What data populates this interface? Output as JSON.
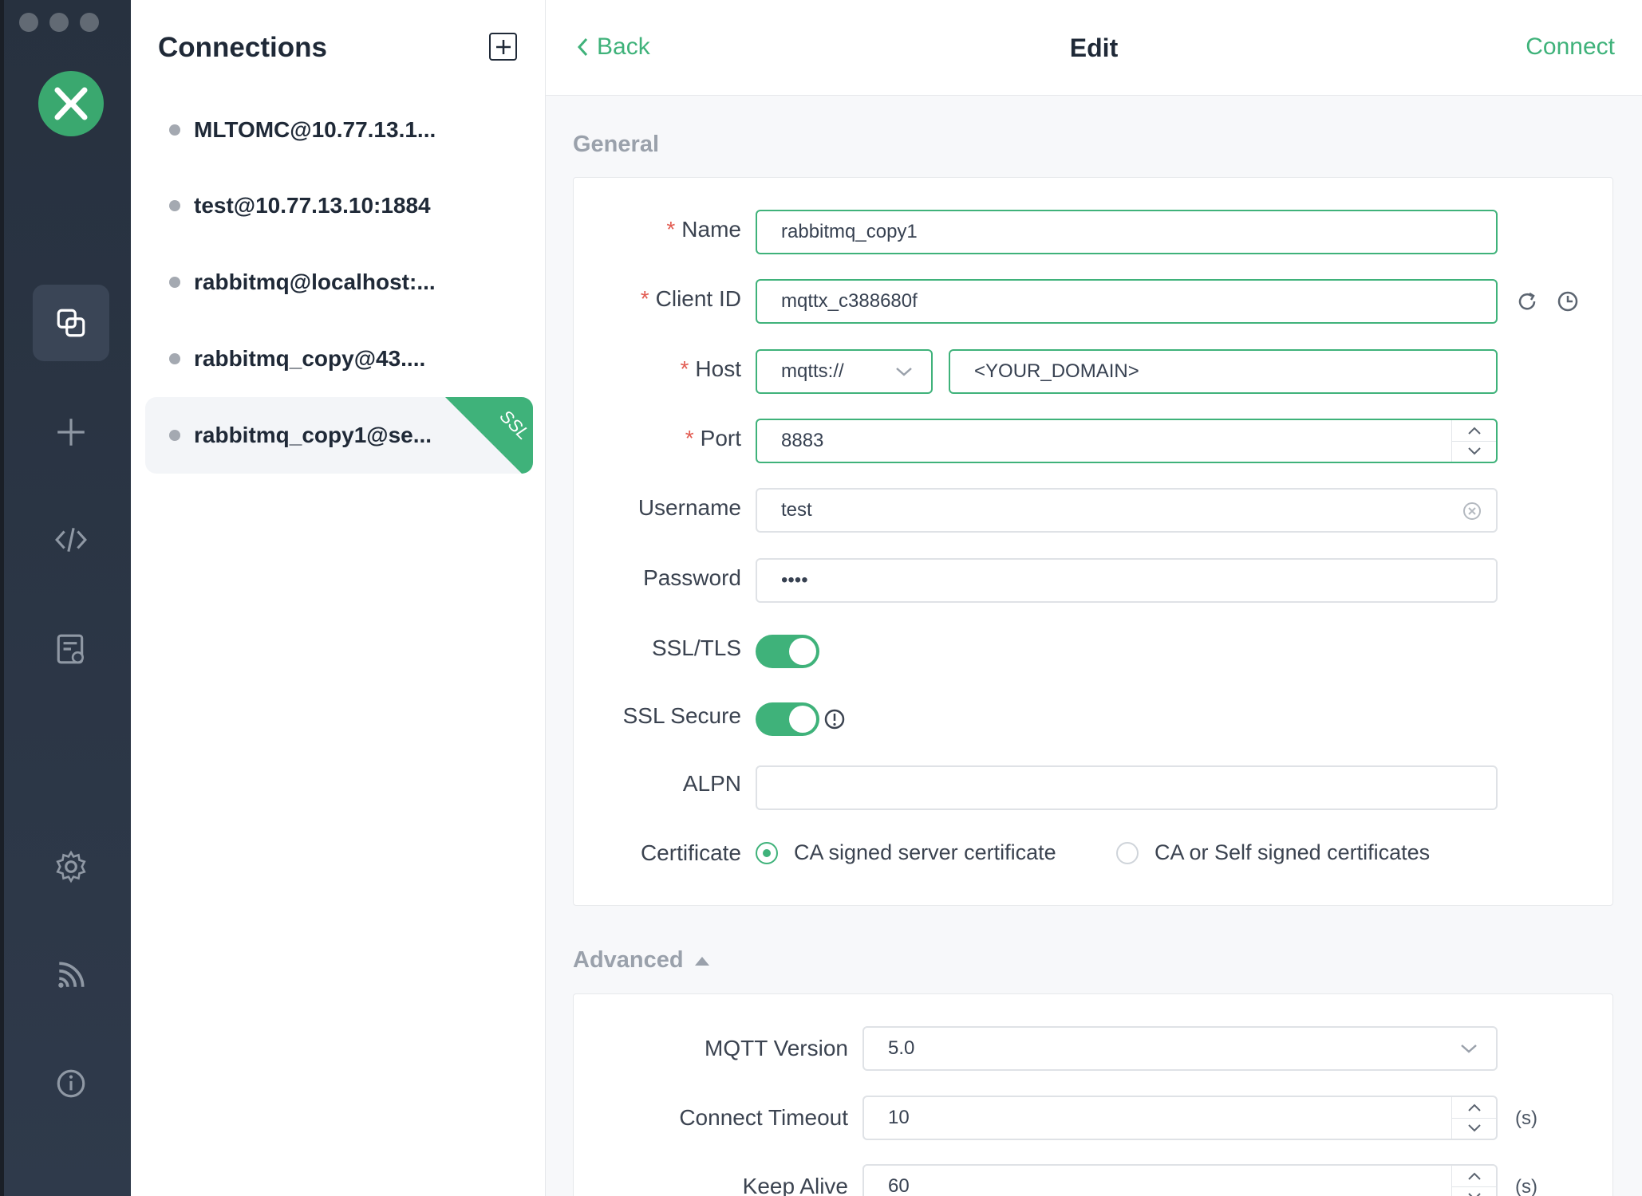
{
  "sidebar": {
    "icons": [
      "connections-icon",
      "add-icon",
      "script-icon",
      "log-icon",
      "settings-icon",
      "feed-icon",
      "info-icon"
    ]
  },
  "connections": {
    "title": "Connections",
    "items": [
      {
        "label": "MLTOMC@10.77.13.1..."
      },
      {
        "label": "test@10.77.13.10:1884"
      },
      {
        "label": "rabbitmq@localhost:..."
      },
      {
        "label": "rabbitmq_copy@43...."
      },
      {
        "label": "rabbitmq_copy1@se...",
        "badge": "SSL",
        "selected": true
      }
    ]
  },
  "header": {
    "back_label": "Back",
    "title": "Edit",
    "connect_label": "Connect"
  },
  "general": {
    "section_title": "General",
    "name": {
      "label": "Name",
      "value": "rabbitmq_copy1"
    },
    "client_id": {
      "label": "Client ID",
      "value": "mqttx_c388680f"
    },
    "host": {
      "label": "Host",
      "protocol": "mqtts://",
      "value": "<YOUR_DOMAIN>"
    },
    "port": {
      "label": "Port",
      "value": "8883"
    },
    "username": {
      "label": "Username",
      "value": "test"
    },
    "password": {
      "label": "Password",
      "value": "••••"
    },
    "ssl_tls": {
      "label": "SSL/TLS",
      "enabled": true
    },
    "ssl_secure": {
      "label": "SSL Secure",
      "enabled": true
    },
    "alpn": {
      "label": "ALPN",
      "value": ""
    },
    "certificate": {
      "label": "Certificate",
      "options": [
        "CA signed server certificate",
        "CA or Self signed certificates"
      ],
      "selected": "CA signed server certificate"
    }
  },
  "advanced": {
    "section_title": "Advanced",
    "mqtt_version": {
      "label": "MQTT Version",
      "value": "5.0"
    },
    "connect_timeout": {
      "label": "Connect Timeout",
      "value": "10",
      "unit": "(s)"
    },
    "keep_alive": {
      "label": "Keep Alive",
      "value": "60",
      "unit": "(s)"
    }
  },
  "colors": {
    "accent": "#3fb27a",
    "required": "#e25c52",
    "rail": "#2b3443"
  }
}
